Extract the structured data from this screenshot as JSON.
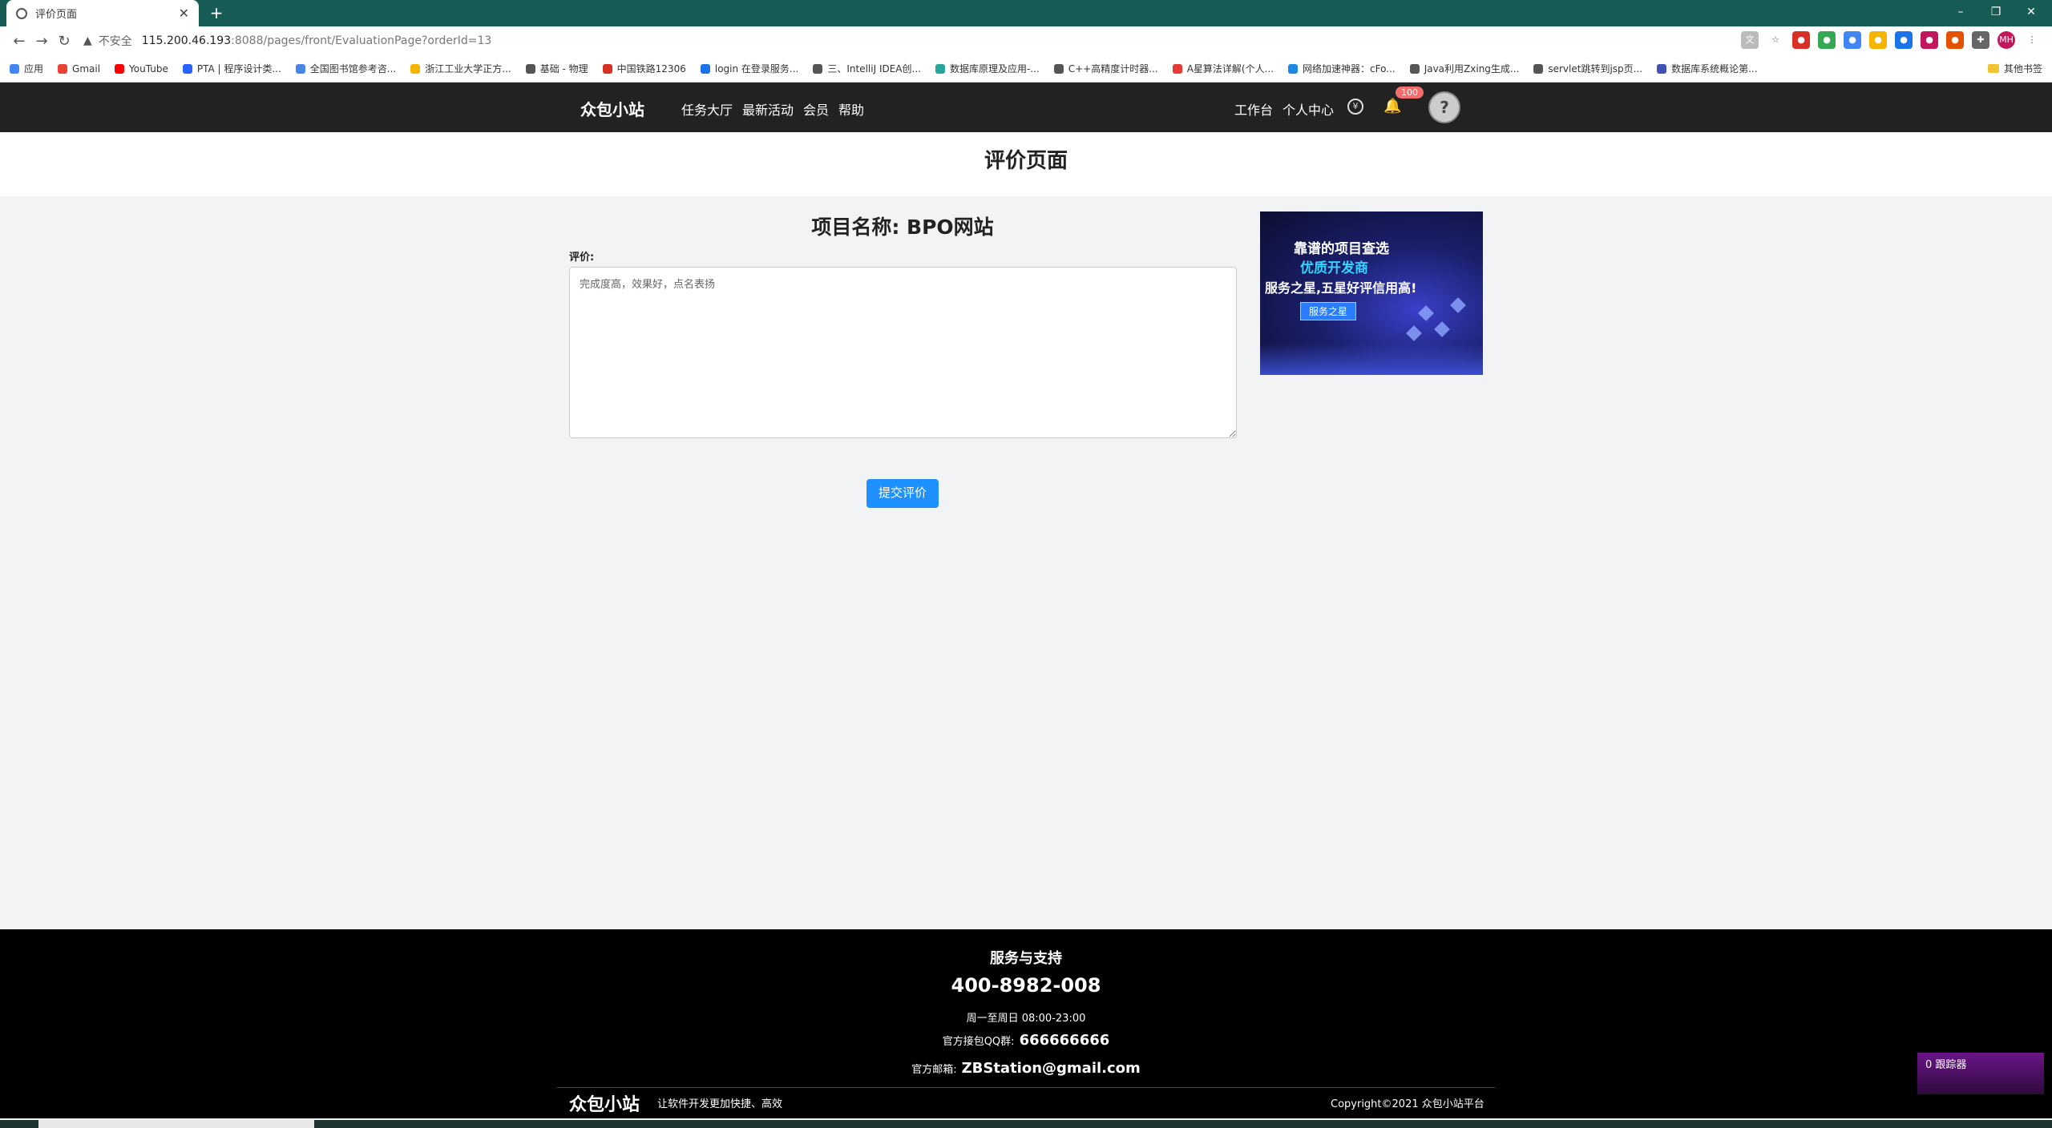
{
  "browser": {
    "tab_title": "评价页面",
    "url_insecure_label": "不安全",
    "url_host": "115.200.46.193",
    "url_path": ":8088/pages/front/EvaluationPage?orderId=13",
    "bookmarks": [
      "应用",
      "Gmail",
      "YouTube",
      "PTA | 程序设计类...",
      "全国图书馆参考咨...",
      "浙江工业大学正方...",
      "基础 - 物理",
      "中国铁路12306",
      "login 在登录服务...",
      "三、IntelliJ IDEA创...",
      "数据库原理及应用-...",
      "C++高精度计时器...",
      "A星算法详解(个人...",
      "网络加速神器：cFo...",
      "Java利用Zxing生成...",
      "servlet跳转到jsp页...",
      "数据库系统概论第..."
    ],
    "other_bookmarks": "其他书签",
    "bookmark_colors": [
      "#4285f4",
      "#ea4335",
      "#ff0000",
      "#2962ff",
      "#4a86e8",
      "#f4b400",
      "#555555",
      "#d93025",
      "#1a73e8",
      "#555555",
      "#26a69a",
      "#555555",
      "#e53935",
      "#1e88e5",
      "#555555",
      "#555555",
      "#3f51b5"
    ]
  },
  "nav": {
    "brand": "众包小站",
    "menu": [
      "任务大厅",
      "最新活动",
      "会员",
      "帮助"
    ],
    "workbench": "工作台",
    "personal_center": "个人中心",
    "yen_icon_text": "¥",
    "notification_count": "100"
  },
  "page": {
    "title": "评价页面",
    "project_title": "项目名称: BPO网站",
    "eval_label": "评价:",
    "eval_text": "完成度高，效果好，点名表扬",
    "submit_label": "提交评价"
  },
  "ad": {
    "line1": "靠谱的项目查选",
    "line2": "优质开发商",
    "line3": "服务之星,五星好评信用高!",
    "button": "服务之星"
  },
  "footer": {
    "title": "服务与支持",
    "phone": "400-8982-008",
    "hours": "周一至周日 08:00-23:00",
    "qq_label": "官方接包QQ群:",
    "qq_value": "666666666",
    "mail_label": "官方邮箱:",
    "mail_value": "ZBStation@gmail.com",
    "brand": "众包小站",
    "slogan": "让软件开发更加快捷、高效",
    "copyright": "Copyright©2021 众包小站平台"
  },
  "tracker": {
    "label": "0 跟踪器"
  }
}
